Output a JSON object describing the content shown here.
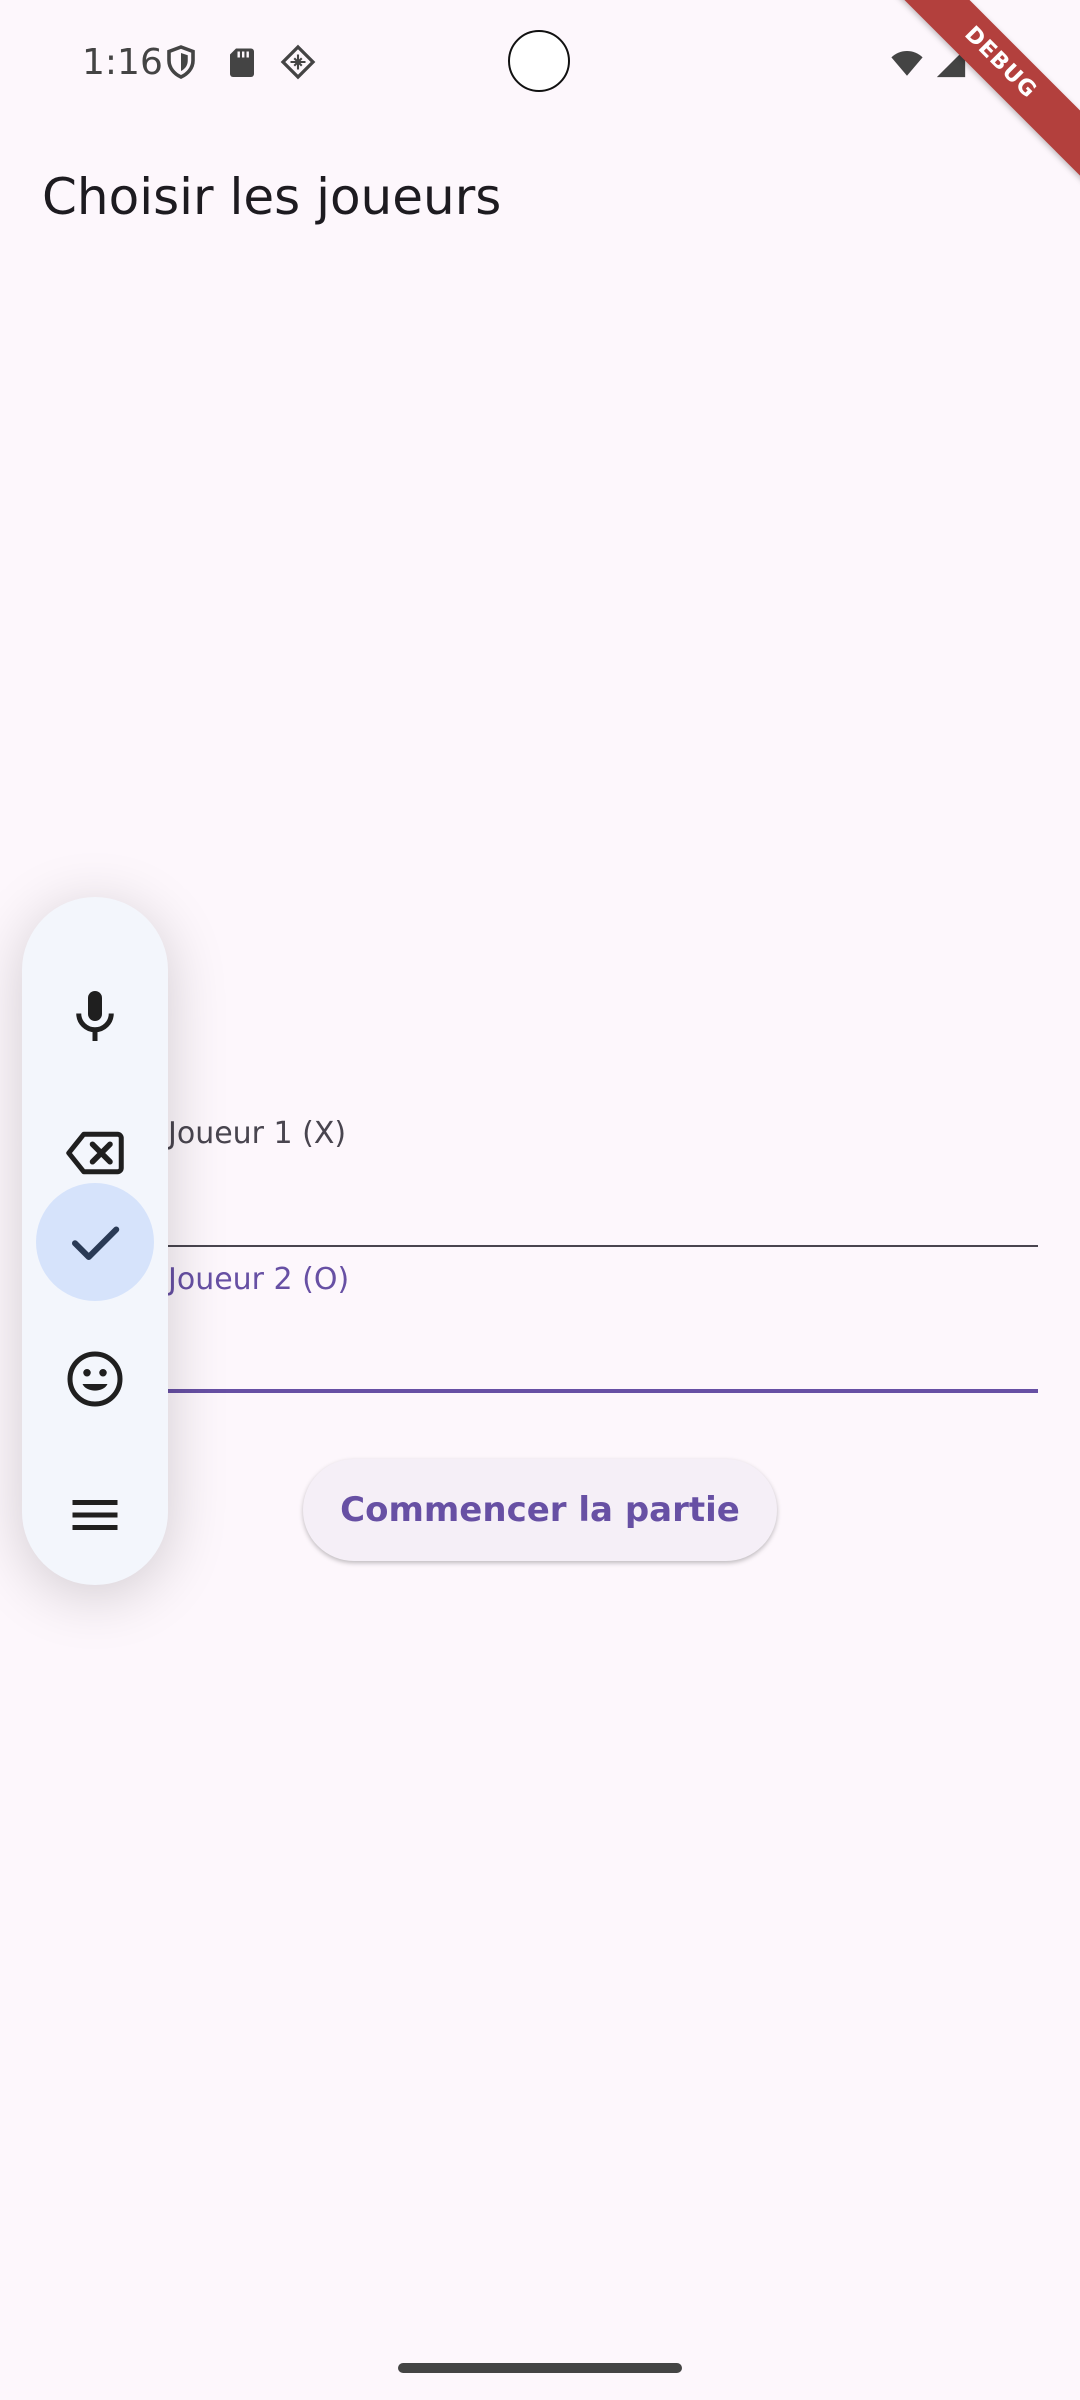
{
  "status_bar": {
    "time": "1:16",
    "left_icons": [
      "shield-icon",
      "sd-card-icon",
      "diamond-grid-icon"
    ],
    "right_icons": [
      "wifi-icon",
      "signal-icon",
      "battery-icon"
    ]
  },
  "debug_banner": {
    "label": "DEBUG",
    "color": "#b3403d"
  },
  "app_bar": {
    "title": "Choisir les joueurs"
  },
  "form": {
    "player1": {
      "label": "Joueur 1 (X)",
      "value": ""
    },
    "player2": {
      "label": "Joueur 2 (O)",
      "value": "",
      "focused": true
    }
  },
  "actions": {
    "start_label": "Commencer la partie"
  },
  "tool_panel": {
    "buttons": [
      {
        "icon": "microphone-icon",
        "active": false
      },
      {
        "icon": "backspace-icon",
        "active": false
      },
      {
        "icon": "check-icon",
        "active": true
      },
      {
        "icon": "emoji-icon",
        "active": false
      },
      {
        "icon": "menu-icon",
        "active": false
      }
    ]
  },
  "colors": {
    "accent": "#6750a4",
    "background": "#fdf7fc",
    "panel": "#f3f6fc",
    "panel_active": "#d6e3fb"
  }
}
